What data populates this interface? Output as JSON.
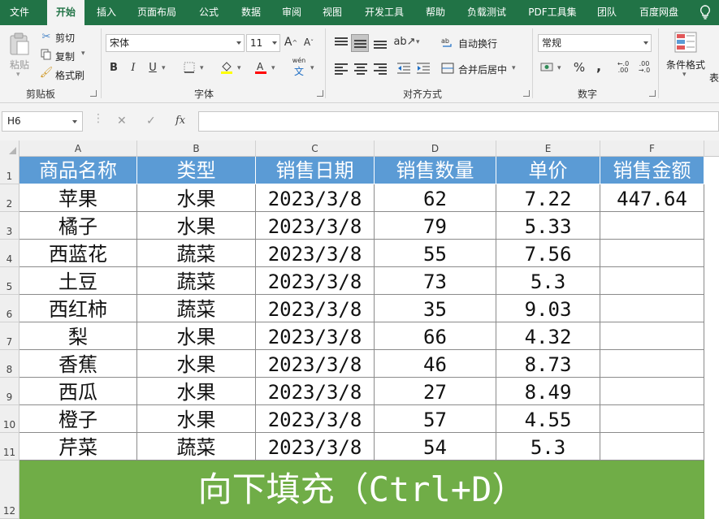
{
  "menu": {
    "tabs": [
      "文件",
      "开始",
      "插入",
      "页面布局",
      "公式",
      "数据",
      "审阅",
      "视图",
      "开发工具",
      "帮助",
      "负载测试",
      "PDF工具集",
      "团队",
      "百度网盘"
    ],
    "active": "开始"
  },
  "ribbon": {
    "clipboard": {
      "paste_label": "粘贴",
      "cut_label": "剪切",
      "copy_label": "复制",
      "format_painter_label": "格式刷",
      "group_label": "剪贴板"
    },
    "font": {
      "font_name": "宋体",
      "font_size": "11",
      "bold": "B",
      "italic": "I",
      "underline": "U",
      "grow_font": "A",
      "shrink_font": "A",
      "phonetic": "wén",
      "group_label": "字体"
    },
    "alignment": {
      "wrap_text_label": "自动换行",
      "merge_center_label": "合并后居中",
      "group_label": "对齐方式"
    },
    "number": {
      "format": "常规",
      "percent": "%",
      "comma": ",",
      "group_label": "数字"
    },
    "styles": {
      "conditional_format_label": "条件格式",
      "table_label_partial": "表"
    }
  },
  "formula_bar": {
    "name_box": "H6",
    "cancel_icon": "✕",
    "enter_icon": "✓",
    "fx_label": "fx",
    "formula": ""
  },
  "sheet": {
    "columns": [
      "A",
      "B",
      "C",
      "D",
      "E",
      "F"
    ],
    "row_numbers": [
      "1",
      "2",
      "3",
      "4",
      "5",
      "6",
      "7",
      "8",
      "9",
      "10",
      "11",
      "12"
    ],
    "headers": [
      "商品名称",
      "类型",
      "销售日期",
      "销售数量",
      "单价",
      "销售金额"
    ],
    "rows": [
      [
        "苹果",
        "水果",
        "2023/3/8",
        "62",
        "7.22",
        "447.64"
      ],
      [
        "橘子",
        "水果",
        "2023/3/8",
        "79",
        "5.33",
        ""
      ],
      [
        "西蓝花",
        "蔬菜",
        "2023/3/8",
        "55",
        "7.56",
        ""
      ],
      [
        "土豆",
        "蔬菜",
        "2023/3/8",
        "73",
        "5.3",
        ""
      ],
      [
        "西红柿",
        "蔬菜",
        "2023/3/8",
        "35",
        "9.03",
        ""
      ],
      [
        "梨",
        "水果",
        "2023/3/8",
        "66",
        "4.32",
        ""
      ],
      [
        "香蕉",
        "水果",
        "2023/3/8",
        "46",
        "8.73",
        ""
      ],
      [
        "西瓜",
        "水果",
        "2023/3/8",
        "27",
        "8.49",
        ""
      ],
      [
        "橙子",
        "水果",
        "2023/3/8",
        "57",
        "4.55",
        ""
      ],
      [
        "芹菜",
        "蔬菜",
        "2023/3/8",
        "54",
        "5.3",
        ""
      ]
    ],
    "header_color": "#5b9bd5",
    "banner_color": "#70ad47"
  },
  "banner": {
    "text_cn": "向下填充",
    "text_shortcut": "（Ctrl+D）"
  },
  "colors": {
    "menu_bg": "#217346",
    "ribbon_bg": "#f3f3f3"
  }
}
